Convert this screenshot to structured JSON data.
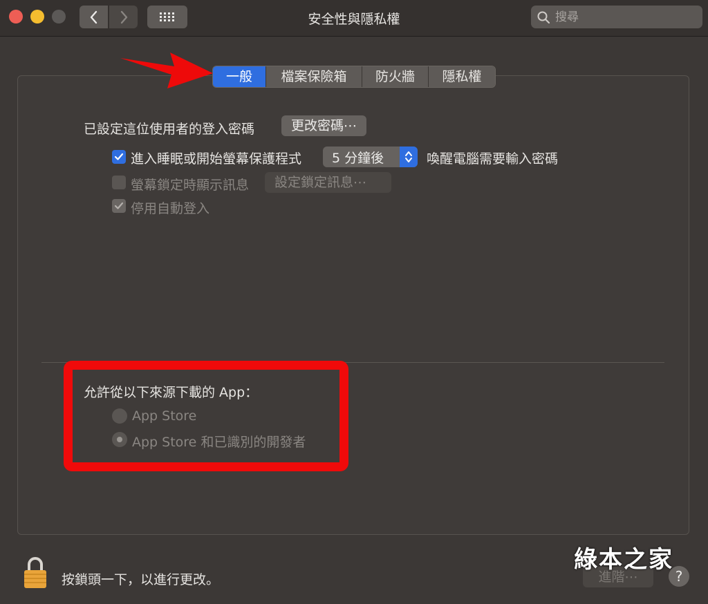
{
  "window": {
    "title": "安全性與隱私權",
    "search_placeholder": "搜尋"
  },
  "tabs": [
    {
      "label": "一般",
      "active": true
    },
    {
      "label": "檔案保險箱",
      "active": false
    },
    {
      "label": "防火牆",
      "active": false
    },
    {
      "label": "隱私權",
      "active": false
    }
  ],
  "general": {
    "password_set_label": "已設定這位使用者的登入密碼",
    "change_password_button": "更改密碼⋯",
    "require_password": {
      "checked": true,
      "label": "進入睡眠或開始螢幕保護程式",
      "delay_value": "5 分鐘後",
      "suffix": "喚醒電腦需要輸入密碼"
    },
    "lock_message": {
      "checked": false,
      "label": "螢幕鎖定時顯示訊息",
      "button": "設定鎖定訊息⋯"
    },
    "disable_auto_login": {
      "checked": true,
      "label": "停用自動登入"
    }
  },
  "downloads": {
    "heading": "允許從以下來源下載的 App：",
    "options": [
      {
        "label": "App Store",
        "selected": false
      },
      {
        "label": "App Store 和已識別的開發者",
        "selected": true
      }
    ]
  },
  "footer": {
    "lock_text": "按鎖頭一下，以進行更改。",
    "advanced_button": "進階⋯",
    "help": "?",
    "watermark": "綠本之家"
  },
  "colors": {
    "accent": "#2f6ee0",
    "annotation": "#f00a0a",
    "background": "#3c3836"
  },
  "icons": [
    "back-icon",
    "forward-icon",
    "grid-icon",
    "search-icon",
    "checkmark-icon",
    "updown-arrows-icon",
    "lock-icon",
    "arrow-annotation"
  ]
}
